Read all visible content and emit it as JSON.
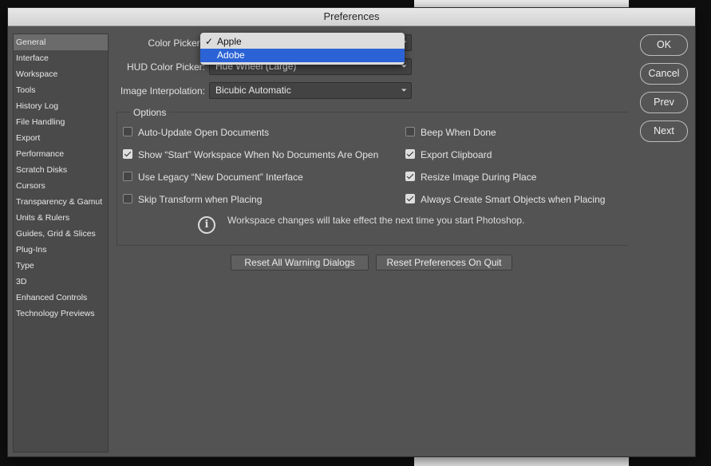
{
  "window": {
    "title": "Preferences"
  },
  "sidebar": {
    "items": [
      {
        "label": "General",
        "selected": true
      },
      {
        "label": "Interface"
      },
      {
        "label": "Workspace"
      },
      {
        "label": "Tools"
      },
      {
        "label": "History Log"
      },
      {
        "label": "File Handling"
      },
      {
        "label": "Export"
      },
      {
        "label": "Performance"
      },
      {
        "label": "Scratch Disks"
      },
      {
        "label": "Cursors"
      },
      {
        "label": "Transparency & Gamut"
      },
      {
        "label": "Units & Rulers"
      },
      {
        "label": "Guides, Grid & Slices"
      },
      {
        "label": "Plug-Ins"
      },
      {
        "label": "Type"
      },
      {
        "label": "3D"
      },
      {
        "label": "Enhanced Controls"
      },
      {
        "label": "Technology Previews"
      }
    ]
  },
  "fields": {
    "color_picker": {
      "label": "Color Picker:",
      "options": [
        "Apple",
        "Adobe"
      ],
      "checked_option": "Apple",
      "highlighted_option": "Adobe"
    },
    "hud_color_picker": {
      "label": "HUD Color Picker:",
      "value": "Hue Wheel (Large)"
    },
    "image_interpolation": {
      "label": "Image Interpolation:",
      "value": "Bicubic Automatic"
    }
  },
  "options": {
    "title": "Options",
    "left": [
      {
        "label": "Auto-Update Open Documents",
        "checked": false
      },
      {
        "label": "Show “Start” Workspace When No Documents Are Open",
        "checked": true
      },
      {
        "label": "Use Legacy “New Document” Interface",
        "checked": false
      },
      {
        "label": "Skip Transform when Placing",
        "checked": false
      }
    ],
    "right": [
      {
        "label": "Beep When Done",
        "checked": false
      },
      {
        "label": "Export Clipboard",
        "checked": true
      },
      {
        "label": "Resize Image During Place",
        "checked": true
      },
      {
        "label": "Always Create Smart Objects when Placing",
        "checked": true
      }
    ],
    "info": "Workspace changes will take effect the next time you start Photoshop."
  },
  "buttons": {
    "reset_warnings": "Reset All Warning Dialogs",
    "reset_on_quit": "Reset Preferences On Quit",
    "ok": "OK",
    "cancel": "Cancel",
    "prev": "Prev",
    "next": "Next"
  },
  "colors": {
    "dialog_bg": "#535353",
    "highlight": "#2b63d6"
  }
}
